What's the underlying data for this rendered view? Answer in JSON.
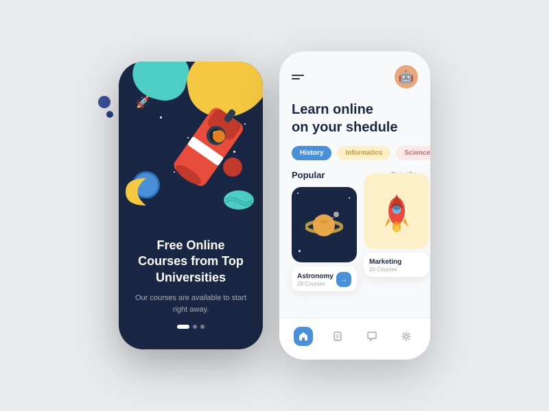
{
  "left_phone": {
    "title": "Free Online Courses from Top Universities",
    "subtitle": "Our courses are available to start right away.",
    "dots": [
      "active",
      "inactive",
      "inactive"
    ]
  },
  "right_phone": {
    "header": {
      "menu_icon": "☰",
      "avatar_emoji": "🤖"
    },
    "title": "Learn online\non your shedule",
    "categories": [
      {
        "label": "History",
        "style": "blue"
      },
      {
        "label": "Informatics",
        "style": "yellow"
      },
      {
        "label": "Science",
        "style": "pink"
      }
    ],
    "popular_label": "Popular",
    "see_all_label": "See all >",
    "cards": [
      {
        "title": "Astronomy",
        "subtitle": "28 Courses",
        "bg": "dark"
      },
      {
        "title": "Marketing",
        "subtitle": "10 Courses",
        "bg": "yellow"
      }
    ],
    "nav_icons": [
      "home",
      "document",
      "chat",
      "settings"
    ]
  }
}
